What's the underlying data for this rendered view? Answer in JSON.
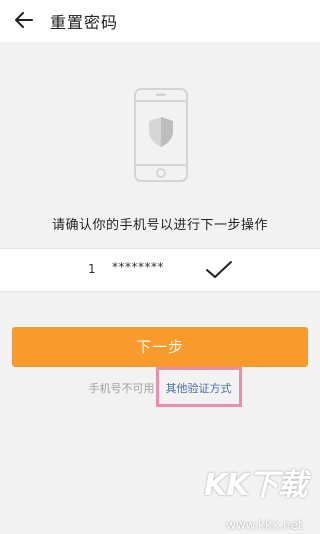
{
  "header": {
    "title": "重置密码",
    "back_icon": "arrow-left-icon"
  },
  "illustration": {
    "icon": "phone-shield-icon"
  },
  "prompt": "请确认你的手机号以进行下一步操作",
  "phone": {
    "prefix": "1",
    "masked": "********",
    "status_icon": "checkmark-icon"
  },
  "actions": {
    "next_label": "下一步",
    "unavailable_text": "手机号不可用，",
    "other_methods_label": "其他验证方式"
  },
  "watermark": {
    "logo": "KK下载",
    "url": "www.kkx.net"
  },
  "colors": {
    "accent": "#fb9a2c",
    "link": "#4a6ea8",
    "highlight": "#e78fb2"
  }
}
